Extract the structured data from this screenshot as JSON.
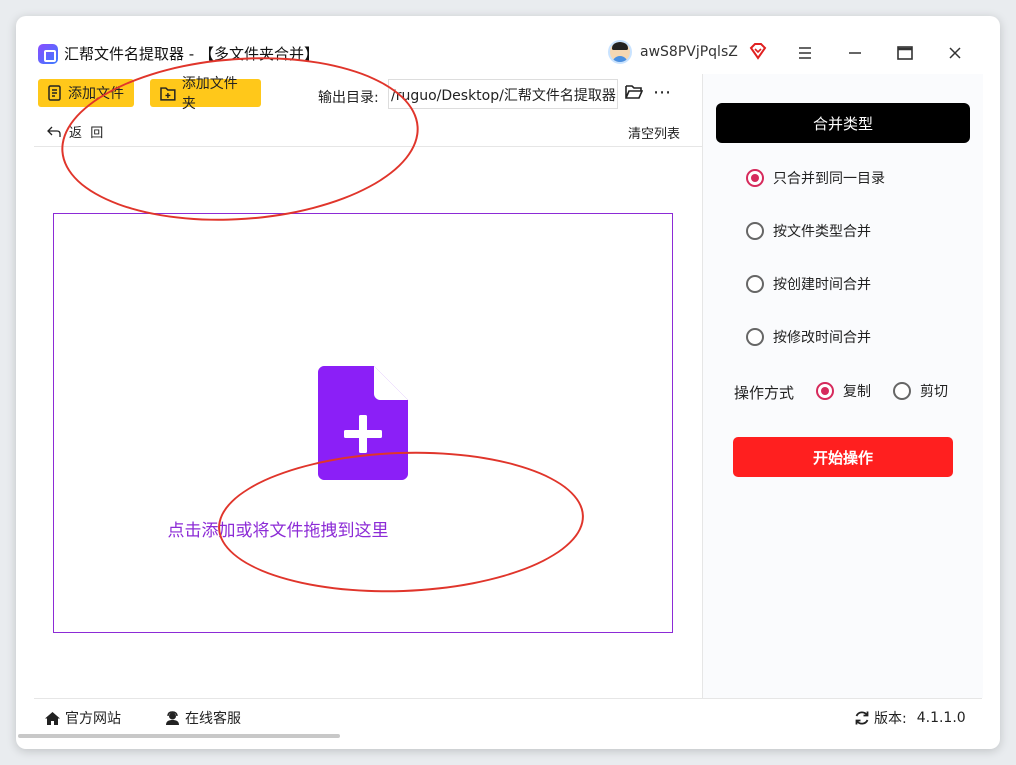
{
  "window": {
    "title": "汇帮文件名提取器 - 【多文件夹合并】",
    "username": "awS8PVjPqlsZ"
  },
  "toolbar": {
    "add_file_label": "添加文件",
    "add_folder_label": "添加文件夹",
    "output_label": "输出目录:",
    "output_path": "/ruguo/Desktop/汇帮文件名提取器",
    "back_label": "返  回",
    "clear_label": "清空列表"
  },
  "dropzone": {
    "hint": "点击添加或将文件拖拽到这里"
  },
  "merge": {
    "header": "合并类型",
    "options": [
      {
        "label": "只合并到同一目录",
        "checked": true
      },
      {
        "label": "按文件类型合并",
        "checked": false
      },
      {
        "label": "按创建时间合并",
        "checked": false
      },
      {
        "label": "按修改时间合并",
        "checked": false
      }
    ],
    "op_label": "操作方式",
    "op_options": [
      {
        "label": "复制",
        "checked": true
      },
      {
        "label": "剪切",
        "checked": false
      }
    ],
    "start_label": "开始操作"
  },
  "footer": {
    "site_label": "官方网站",
    "service_label": "在线客服",
    "version_label": "版本:",
    "version_value": "4.1.1.0"
  },
  "colors": {
    "accent_yellow": "#ffc81a",
    "drop_purple": "#8c2bd6",
    "start_red": "#ff1f1f",
    "radio_pink": "#d62a5c",
    "annotation_red": "#e0352b"
  }
}
